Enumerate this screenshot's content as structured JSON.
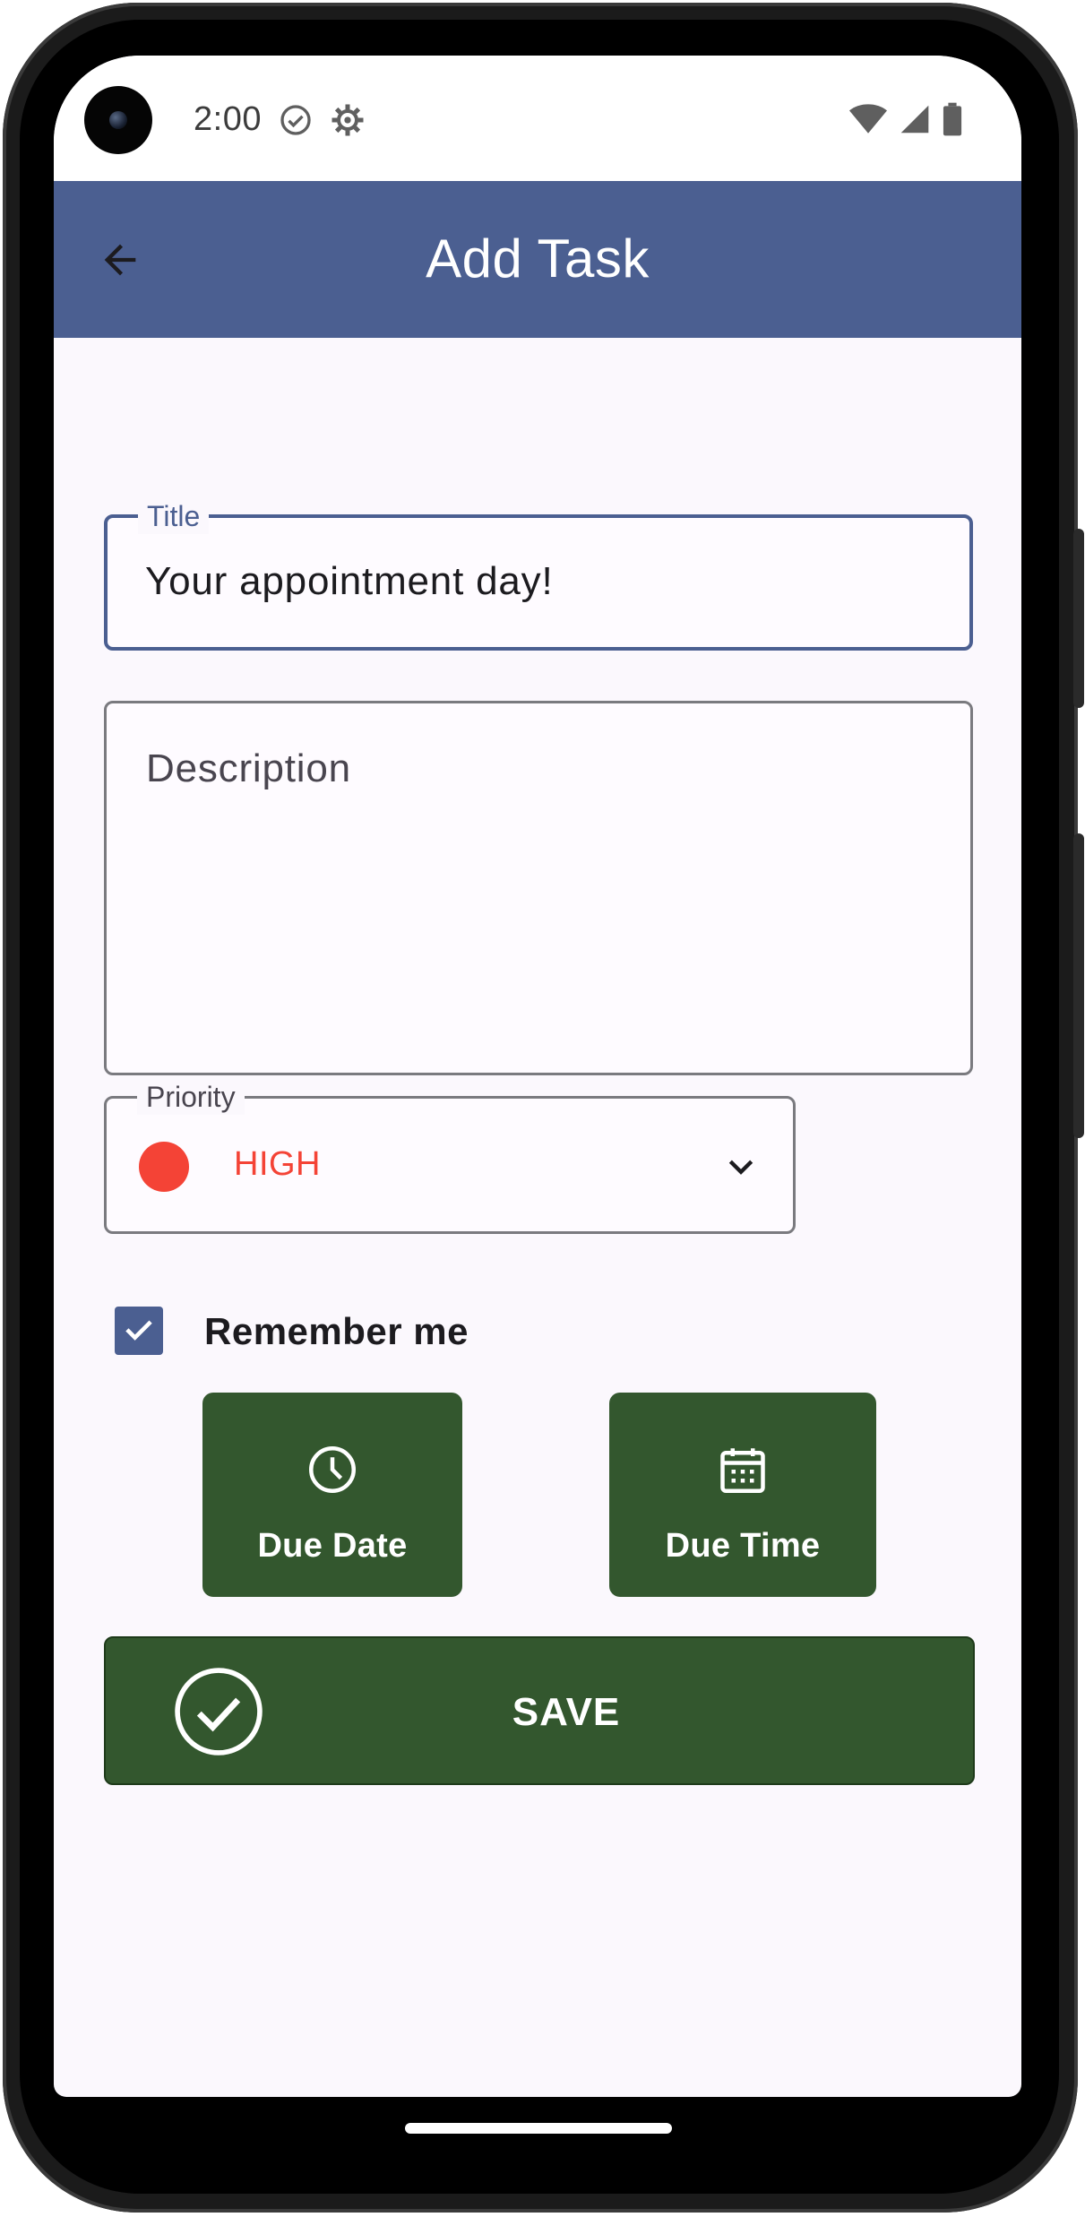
{
  "status_bar": {
    "time": "2:00",
    "left_icons": [
      "check-circle-icon",
      "gear-icon"
    ],
    "right_icons": [
      "wifi-icon",
      "signal-icon",
      "battery-icon"
    ]
  },
  "app_bar": {
    "title": "Add Task",
    "back_icon": "arrow-back-icon",
    "background_color": "#4b5f91"
  },
  "form": {
    "title_field": {
      "label": "Title",
      "value": "Your appointment day!"
    },
    "description_field": {
      "placeholder": "Description",
      "value": ""
    },
    "priority_field": {
      "label": "Priority",
      "value": "HIGH",
      "color": "#f44336"
    },
    "remember": {
      "label": "Remember me",
      "checked": true
    },
    "due_date_button": {
      "label": "Due Date",
      "icon": "clock-icon"
    },
    "due_time_button": {
      "label": "Due Time",
      "icon": "calendar-icon"
    },
    "save_button": {
      "label": "SAVE",
      "icon": "check-circle-icon"
    }
  },
  "colors": {
    "primary": "#4b5f91",
    "button_green": "#33572e",
    "priority_high": "#f44336"
  }
}
